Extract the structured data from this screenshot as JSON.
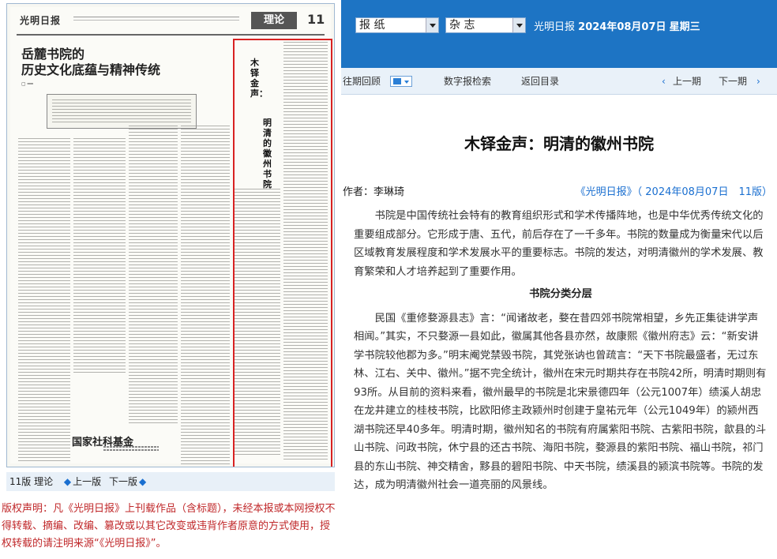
{
  "newspaper": {
    "masthead": "光明日报",
    "section": "理论",
    "page_number": "11",
    "headline_1": "岳麓书院的",
    "headline_2": "历史文化底蕴与精神传统",
    "vertical_title_1": "木铎金声：",
    "vertical_title_2": "明清的徽州书院",
    "fund_logo": "国家社科基金"
  },
  "left_nav": {
    "page_label": "11版 理论",
    "prev": "上一版",
    "next": "下一版"
  },
  "copyright": "版权声明：凡《光明日报》上刊载作品（含标题），未经本报或本网授权不得转载、摘编、改编、篡改或以其它改变或违背作者原意的方式使用，授权转载的请注明来源“《光明日报》”。",
  "selectors": {
    "type": "报 纸",
    "publication": "杂 志"
  },
  "date_info": {
    "paper": "光明日报",
    "date": "2024年08月07日",
    "weekday": "星期三"
  },
  "toolbar": {
    "archive": "往期回顾",
    "digital_search": "数字报检索",
    "back_to_list": "返回目录",
    "prev_issue": "上一期",
    "next_issue": "下一期"
  },
  "article": {
    "title": "木铎金声：明清的徽州书院",
    "author": "作者：李琳琦",
    "source": "《光明日报》（ 2024年08月07日　11版）",
    "paragraph_1": "书院是中国传统社会特有的教育组织形式和学术传播阵地，也是中华优秀传统文化的重要组成部分。它形成于唐、五代，前后存在了一千多年。书院的数量成为衡量宋代以后区域教育发展程度和学术发展水平的重要标志。书院的发达，对明清徽州的学术发展、教育繁荣和人才培养起到了重要作用。",
    "subheading": "书院分类分层",
    "paragraph_2": "民国《重修婺源县志》言：“闻诸故老，婺在昔四郊书院常相望，乡先正集徒讲学声相闻。”其实，不只婺源一县如此，徽属其他各县亦然，故康熙《徽州府志》云：“新安讲学书院较他郡为多。”明末阉党禁毁书院，其党张讷也曾疏言：“天下书院最盛者，无过东林、江右、关中、徽州。”据不完全统计，徽州在宋元时期共存在书院42所，明清时期则有93所。从目前的资料来看，徽州最早的书院是北宋景德四年（公元1007年）绩溪人胡忠在龙井建立的桂枝书院，比欧阳修主政颍州时创建于皇祐元年（公元1049年）的颍州西湖书院还早40多年。明清时期，徽州知名的书院有府属紫阳书院、古紫阳书院，歙县的斗山书院、问政书院，休宁县的还古书院、海阳书院，婺源县的紫阳书院、福山书院，祁门县的东山书院、神交精舍，黟县的碧阳书院、中天书院，绩溪县的颍滨书院等。书院的发达，成为明清徽州社会一道亮丽的风景线。"
  },
  "colors": {
    "brand_blue": "#1d74c4",
    "highlight_red": "#d82222",
    "link_blue": "#1a6fd0",
    "copyright_red": "#c0282a"
  }
}
